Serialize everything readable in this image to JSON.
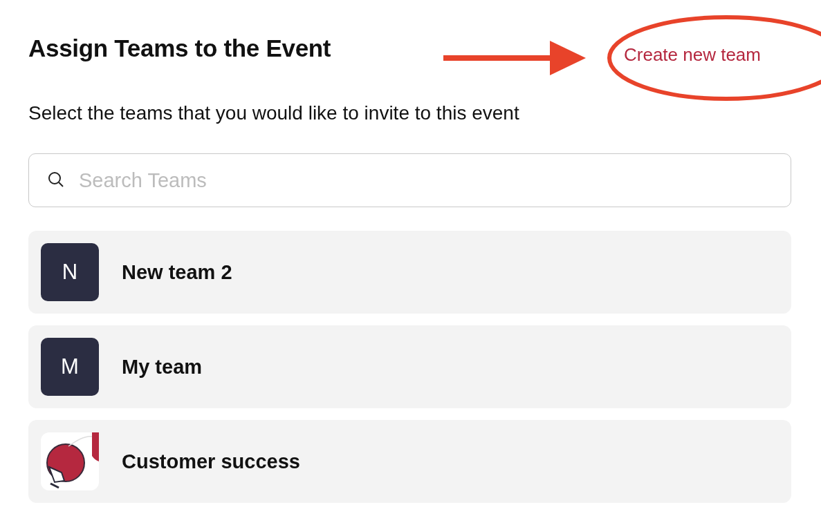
{
  "header": {
    "title": "Assign Teams to the Event",
    "action": "Create new team"
  },
  "subtitle": "Select the teams that you would like to invite to this event",
  "search": {
    "placeholder": "Search Teams"
  },
  "teams": [
    {
      "kind": "letter",
      "avatar": "N",
      "name": "New team 2"
    },
    {
      "kind": "letter",
      "avatar": "M",
      "name": "My team"
    },
    {
      "kind": "picture",
      "name": "Customer success"
    }
  ]
}
